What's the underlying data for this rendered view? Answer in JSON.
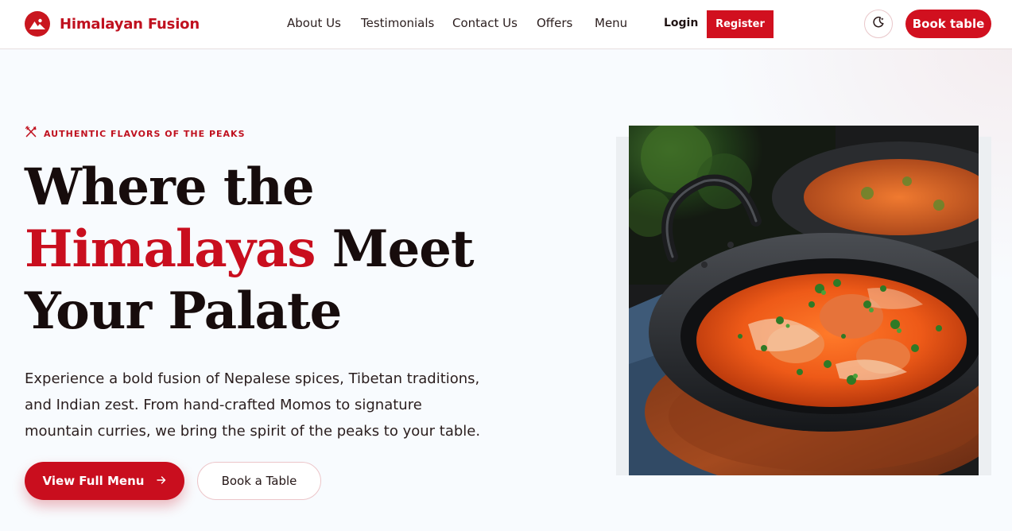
{
  "brand": {
    "name": "Himalayan Fusion",
    "logo_icon": "mountain-logo-icon"
  },
  "nav": {
    "items": [
      {
        "label": "About Us"
      },
      {
        "label": "Testimonials"
      },
      {
        "label": "Contact Us"
      },
      {
        "label": "Offers"
      },
      {
        "label": "Menu"
      }
    ],
    "login_label": "Login",
    "register_label": "Register",
    "theme_icon": "moon-icon",
    "book_table_label": "Book table"
  },
  "hero": {
    "eyebrow": "AUTHENTIC FLAVORS OF THE PEAKS",
    "eyebrow_icon": "utensils-crossed-icon",
    "title_line1": "Where the",
    "title_accent": "Himalayas",
    "title_line2_rest": " Meet",
    "title_line3": "Your Palate",
    "description": "Experience a bold fusion of Nepalese spices, Tibetan traditions, and Indian zest. From hand-crafted Momos to signature mountain curries, we bring the spirit of the peaks to your table.",
    "primary_cta": "View Full Menu",
    "primary_cta_icon": "arrow-right-icon",
    "secondary_cta": "Book a Table"
  },
  "colors": {
    "brand_red": "#c90e1e",
    "page_bg": "#f8fbfe",
    "heading": "#170c0c"
  }
}
